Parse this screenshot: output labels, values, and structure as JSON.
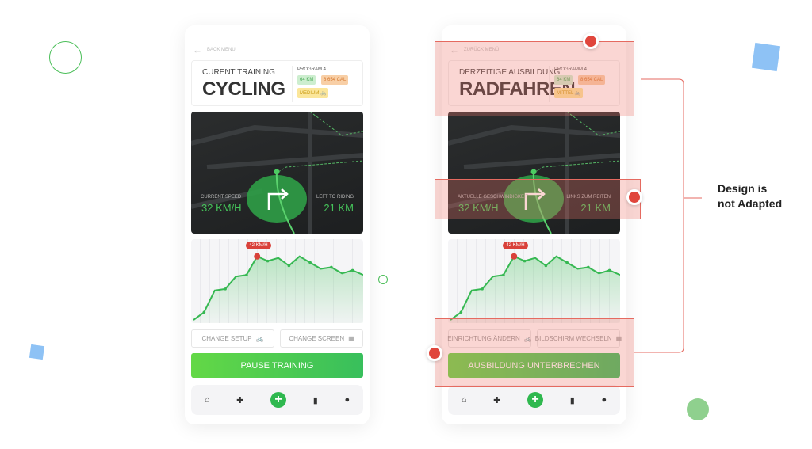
{
  "colors": {
    "accent": "#3cc35a",
    "warning": "#e0463c",
    "overlay": "#f0786e"
  },
  "annotation": {
    "line1": "Design is",
    "line2": "not Adapted"
  },
  "phones": [
    {
      "back": "BACK MENU",
      "subtitle": "CURENT TRAINING",
      "title": "CYCLING",
      "program": "PROGRAM 4",
      "tags": {
        "distance": "64 KM",
        "calories": "8 654 CAL",
        "level": "MEDIUM"
      },
      "speed_label": "CURRENT SPEED",
      "speed_value": "32 KM/H",
      "left_label": "LEFT TO RIDING",
      "left_value": "21 KM",
      "peak_label": "42 KM/H",
      "change_setup": "CHANGE SETUP",
      "change_screen": "CHANGE SCREEN",
      "pause": "PAUSE TRAINING"
    },
    {
      "back": "ZURÜCK MENÜ",
      "subtitle": "DERZEITIGE AUSBILDUNG",
      "title": "RADFAHREN",
      "program": "PROGRAMM 4",
      "tags": {
        "distance": "64 KM",
        "calories": "8 654 CAL",
        "level": "MITTEL"
      },
      "speed_label": "AKTUELLE GESCHWINDIGKEIT",
      "speed_value": "32 KM/H",
      "left_label": "LINKS ZUM REITEN",
      "left_value": "21 KM",
      "peak_label": "42 KM/H",
      "change_setup": "EINRICHTUNG ÄNDERN",
      "change_screen": "BILDSCHIRM WECHSELN",
      "pause": "AUSBILDUNG UNTERBRECHEN"
    }
  ],
  "nav_icons": [
    "home-icon",
    "dumbbell-icon",
    "plus-icon",
    "bar-chart-icon",
    "user-icon"
  ],
  "chart_data": {
    "type": "line",
    "values": [
      1,
      6,
      20,
      21,
      29,
      30,
      42,
      39,
      41,
      36,
      42,
      38,
      34,
      35,
      31,
      33,
      30
    ],
    "peak_index": 6,
    "ylim": [
      0,
      48
    ]
  }
}
